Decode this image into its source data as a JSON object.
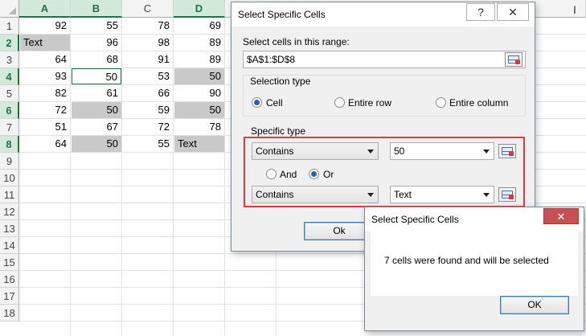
{
  "sheet": {
    "columns": [
      {
        "label": "A",
        "selected": true
      },
      {
        "label": "B",
        "selected": true
      },
      {
        "label": "C",
        "selected": false
      },
      {
        "label": "D",
        "selected": true
      }
    ],
    "rows": [
      {
        "num": "1",
        "selected": false,
        "cells": [
          {
            "v": "92"
          },
          {
            "v": "55"
          },
          {
            "v": "78"
          },
          {
            "v": "69"
          }
        ]
      },
      {
        "num": "2",
        "selected": true,
        "cells": [
          {
            "v": "Text",
            "hl": true,
            "text": true
          },
          {
            "v": "96"
          },
          {
            "v": "98"
          },
          {
            "v": "89"
          }
        ]
      },
      {
        "num": "3",
        "selected": false,
        "cells": [
          {
            "v": "64"
          },
          {
            "v": "68"
          },
          {
            "v": "91"
          },
          {
            "v": "89"
          }
        ]
      },
      {
        "num": "4",
        "selected": true,
        "cells": [
          {
            "v": "93"
          },
          {
            "v": "50",
            "active": true
          },
          {
            "v": "53"
          },
          {
            "v": "50",
            "hl": true
          }
        ]
      },
      {
        "num": "5",
        "selected": false,
        "cells": [
          {
            "v": "82"
          },
          {
            "v": "61"
          },
          {
            "v": "66"
          },
          {
            "v": "90"
          }
        ]
      },
      {
        "num": "6",
        "selected": true,
        "cells": [
          {
            "v": "72"
          },
          {
            "v": "50",
            "hl": true
          },
          {
            "v": "59"
          },
          {
            "v": "50",
            "hl": true
          }
        ]
      },
      {
        "num": "7",
        "selected": false,
        "cells": [
          {
            "v": "51"
          },
          {
            "v": "67"
          },
          {
            "v": "72"
          },
          {
            "v": "78"
          }
        ]
      },
      {
        "num": "8",
        "selected": true,
        "cells": [
          {
            "v": "64"
          },
          {
            "v": "50",
            "hl": true
          },
          {
            "v": "55"
          },
          {
            "v": "Text",
            "hl": true,
            "text": true
          }
        ]
      },
      {
        "num": "9"
      },
      {
        "num": "10"
      },
      {
        "num": "11"
      },
      {
        "num": "12"
      },
      {
        "num": "13"
      },
      {
        "num": "14"
      },
      {
        "num": "15"
      },
      {
        "num": "16"
      },
      {
        "num": "17"
      },
      {
        "num": "18"
      }
    ]
  },
  "dialog": {
    "title": "Select Specific Cells",
    "help_label": "?",
    "close_label": "✕",
    "range_label": "Select cells in this range:",
    "range_value": "$A$1:$D$8",
    "selection_type_label": "Selection type",
    "selection_options": [
      "Cell",
      "Entire row",
      "Entire column"
    ],
    "selection_selected": "Cell",
    "specific_type_label": "Specific type",
    "condition1": {
      "operator": "Contains",
      "value": "50"
    },
    "logic_options": [
      "And",
      "Or"
    ],
    "logic_selected": "Or",
    "condition2": {
      "operator": "Contains",
      "value": "Text"
    },
    "ok_label": "Ok"
  },
  "result_dialog": {
    "title": "Select Specific Cells",
    "close_label": "✕",
    "message": "7 cells were found and will be selected",
    "ok_label": "OK"
  },
  "colors": {
    "accent_green": "#217346",
    "highlight": "#c9c9c9",
    "callout_red": "#e03a3a"
  }
}
